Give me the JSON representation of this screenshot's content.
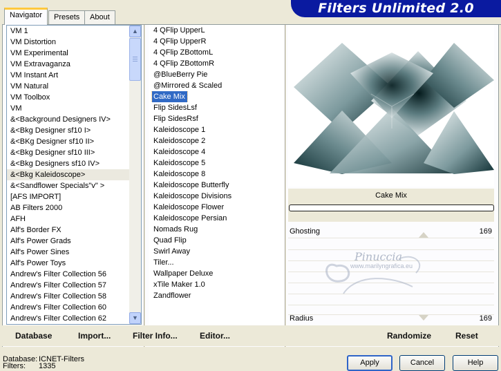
{
  "tabs": [
    "Navigator",
    "Presets",
    "About"
  ],
  "banner": "Filters Unlimited 2.0",
  "categories": [
    "VM 1",
    "VM Distortion",
    "VM Experimental",
    "VM Extravaganza",
    "VM Instant Art",
    "VM Natural",
    "VM Toolbox",
    "VM",
    "&<Background Designers IV>",
    "&<Bkg Designer sf10 I>",
    "&<BKg Designer sf10 II>",
    "&<Bkg Designer sf10 III>",
    "&<Bkg Designers sf10 IV>",
    "&<Bkg Kaleidoscope>",
    "&<Sandflower Specials\"v\" >",
    "[AFS IMPORT]",
    "AB Filters 2000",
    "AFH",
    "Alf's Border FX",
    "Alf's Power Grads",
    "Alf's Power Sines",
    "Alf's Power Toys",
    "Andrew's Filter Collection 56",
    "Andrew's Filter Collection 57",
    "Andrew's Filter Collection 58",
    "Andrew's Filter Collection 60",
    "Andrew's Filter Collection 62"
  ],
  "selected_category": "&<Bkg Kaleidoscope>",
  "filters": [
    "4 QFlip UpperL",
    "4 QFlip UpperR",
    "4 QFlip ZBottomL",
    "4 QFlip ZBottomR",
    "@BlueBerry Pie",
    "@Mirrored & Scaled",
    "Cake Mix",
    "Flip SidesLsf",
    "Flip SidesRsf",
    "Kaleidoscope 1",
    "Kaleidoscope 2",
    "Kaleidoscope 4",
    "Kaleidoscope 5",
    "Kaleidoscope 8",
    "Kaleidoscope Butterfly",
    "Kaleidoscope Divisions",
    "Kaleidoscope Flower",
    "Kaleidoscope Persian",
    "Nomads Rug",
    "Quad Flip",
    "Swirl Away",
    "Tiler...",
    "Wallpaper Deluxe",
    "xTile Maker 1.0",
    "Zandflower"
  ],
  "selected_filter": "Cake Mix",
  "preview_name": "Cake Mix",
  "sliders": [
    {
      "label": "Ghosting",
      "value": "169"
    },
    {
      "label": "Radius",
      "value": "169"
    }
  ],
  "watermark": {
    "line1": "Pinuccia",
    "line2": "www.marilyngrafica.eu"
  },
  "bottom_buttons": {
    "database": "Database",
    "import": "Import...",
    "filter_info": "Filter Info...",
    "editor": "Editor...",
    "randomize": "Randomize",
    "reset": "Reset"
  },
  "footer": {
    "database_label": "Database:",
    "database_value": "ICNET-Filters",
    "filters_label": "Filters:",
    "filters_value": "1335"
  },
  "dialog_buttons": {
    "apply": "Apply",
    "cancel": "Cancel",
    "help": "Help"
  },
  "colors": {
    "banner": "#0a1aa0",
    "selection": "#316ac5",
    "accent_tab": "#ffc83c"
  }
}
